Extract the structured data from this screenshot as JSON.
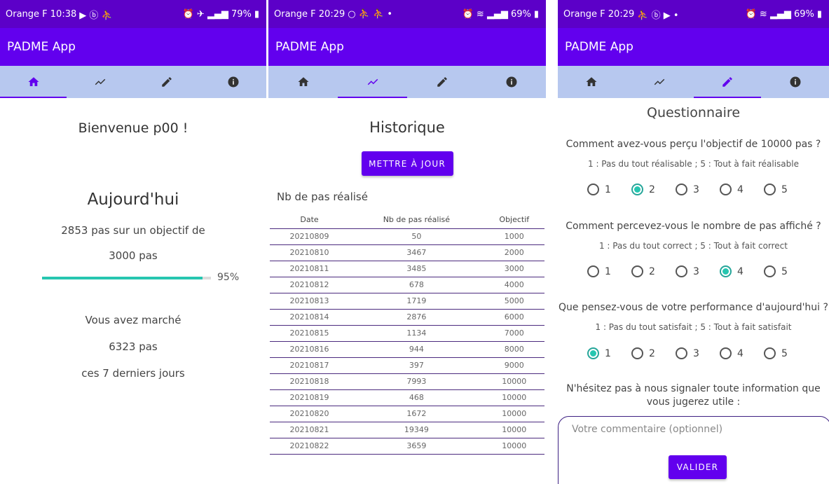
{
  "screen1": {
    "status": {
      "carrier_time": "Orange F 10:38",
      "battery": "79%"
    },
    "app_title": "PADME App",
    "welcome": "Bienvenue p00 !",
    "today_title": "Aujourd'hui",
    "steps_line": "2853 pas sur un objectif de",
    "goal_line": "3000 pas",
    "progress_fraction": 0.95,
    "progress_label": "95%",
    "walked_line1": "Vous avez marché",
    "walked_line2": "6323 pas",
    "walked_line3": "ces 7 derniers jours"
  },
  "screen2": {
    "status": {
      "carrier_time": "Orange F 20:29",
      "battery": "69%"
    },
    "app_title": "PADME App",
    "title": "Historique",
    "update_button": "METTRE À JOUR",
    "section_label": "Nb de pas réalisé",
    "columns": [
      "Date",
      "Nb de pas réalisé",
      "Objectif"
    ],
    "rows": [
      [
        "20210809",
        "50",
        "1000"
      ],
      [
        "20210810",
        "3467",
        "2000"
      ],
      [
        "20210811",
        "3485",
        "3000"
      ],
      [
        "20210812",
        "678",
        "4000"
      ],
      [
        "20210813",
        "1719",
        "5000"
      ],
      [
        "20210814",
        "2876",
        "6000"
      ],
      [
        "20210815",
        "1134",
        "7000"
      ],
      [
        "20210816",
        "944",
        "8000"
      ],
      [
        "20210817",
        "397",
        "9000"
      ],
      [
        "20210818",
        "7993",
        "10000"
      ],
      [
        "20210819",
        "468",
        "10000"
      ],
      [
        "20210820",
        "1672",
        "10000"
      ],
      [
        "20210821",
        "19349",
        "10000"
      ],
      [
        "20210822",
        "3659",
        "10000"
      ]
    ]
  },
  "screen3": {
    "status": {
      "carrier_time": "Orange F 20:29",
      "battery": "69%"
    },
    "app_title": "PADME App",
    "title": "Questionnaire",
    "q1": "Comment avez-vous perçu l'objectif de 10000 pas ?",
    "q1_scale": "1 : Pas du tout réalisable ; 5 : Tout à fait réalisable",
    "q1_selected": 2,
    "q2": "Comment percevez-vous le nombre de pas affiché ?",
    "q2_scale": "1 : Pas du tout correct ; 5 : Tout à fait correct",
    "q2_selected": 4,
    "q3": "Que pensez-vous de votre performance d'aujourd'hui ?",
    "q3_scale": "1 : Pas du tout satisfait ; 5 : Tout à fait satisfait",
    "q3_selected": 1,
    "options": [
      "1",
      "2",
      "3",
      "4",
      "5"
    ],
    "comment_prompt_1": "N'hésitez pas à nous signaler toute information que",
    "comment_prompt_2": "vous jugerez utile :",
    "comment_placeholder": "Votre commentaire (optionnel)",
    "submit_button": "VALIDER"
  },
  "tabs": [
    "home-icon",
    "chart-icon",
    "edit-icon",
    "info-icon"
  ],
  "colors": {
    "primary": "#6200ee",
    "tabbar": "#b7c8ef",
    "accent": "#26c6b0"
  }
}
